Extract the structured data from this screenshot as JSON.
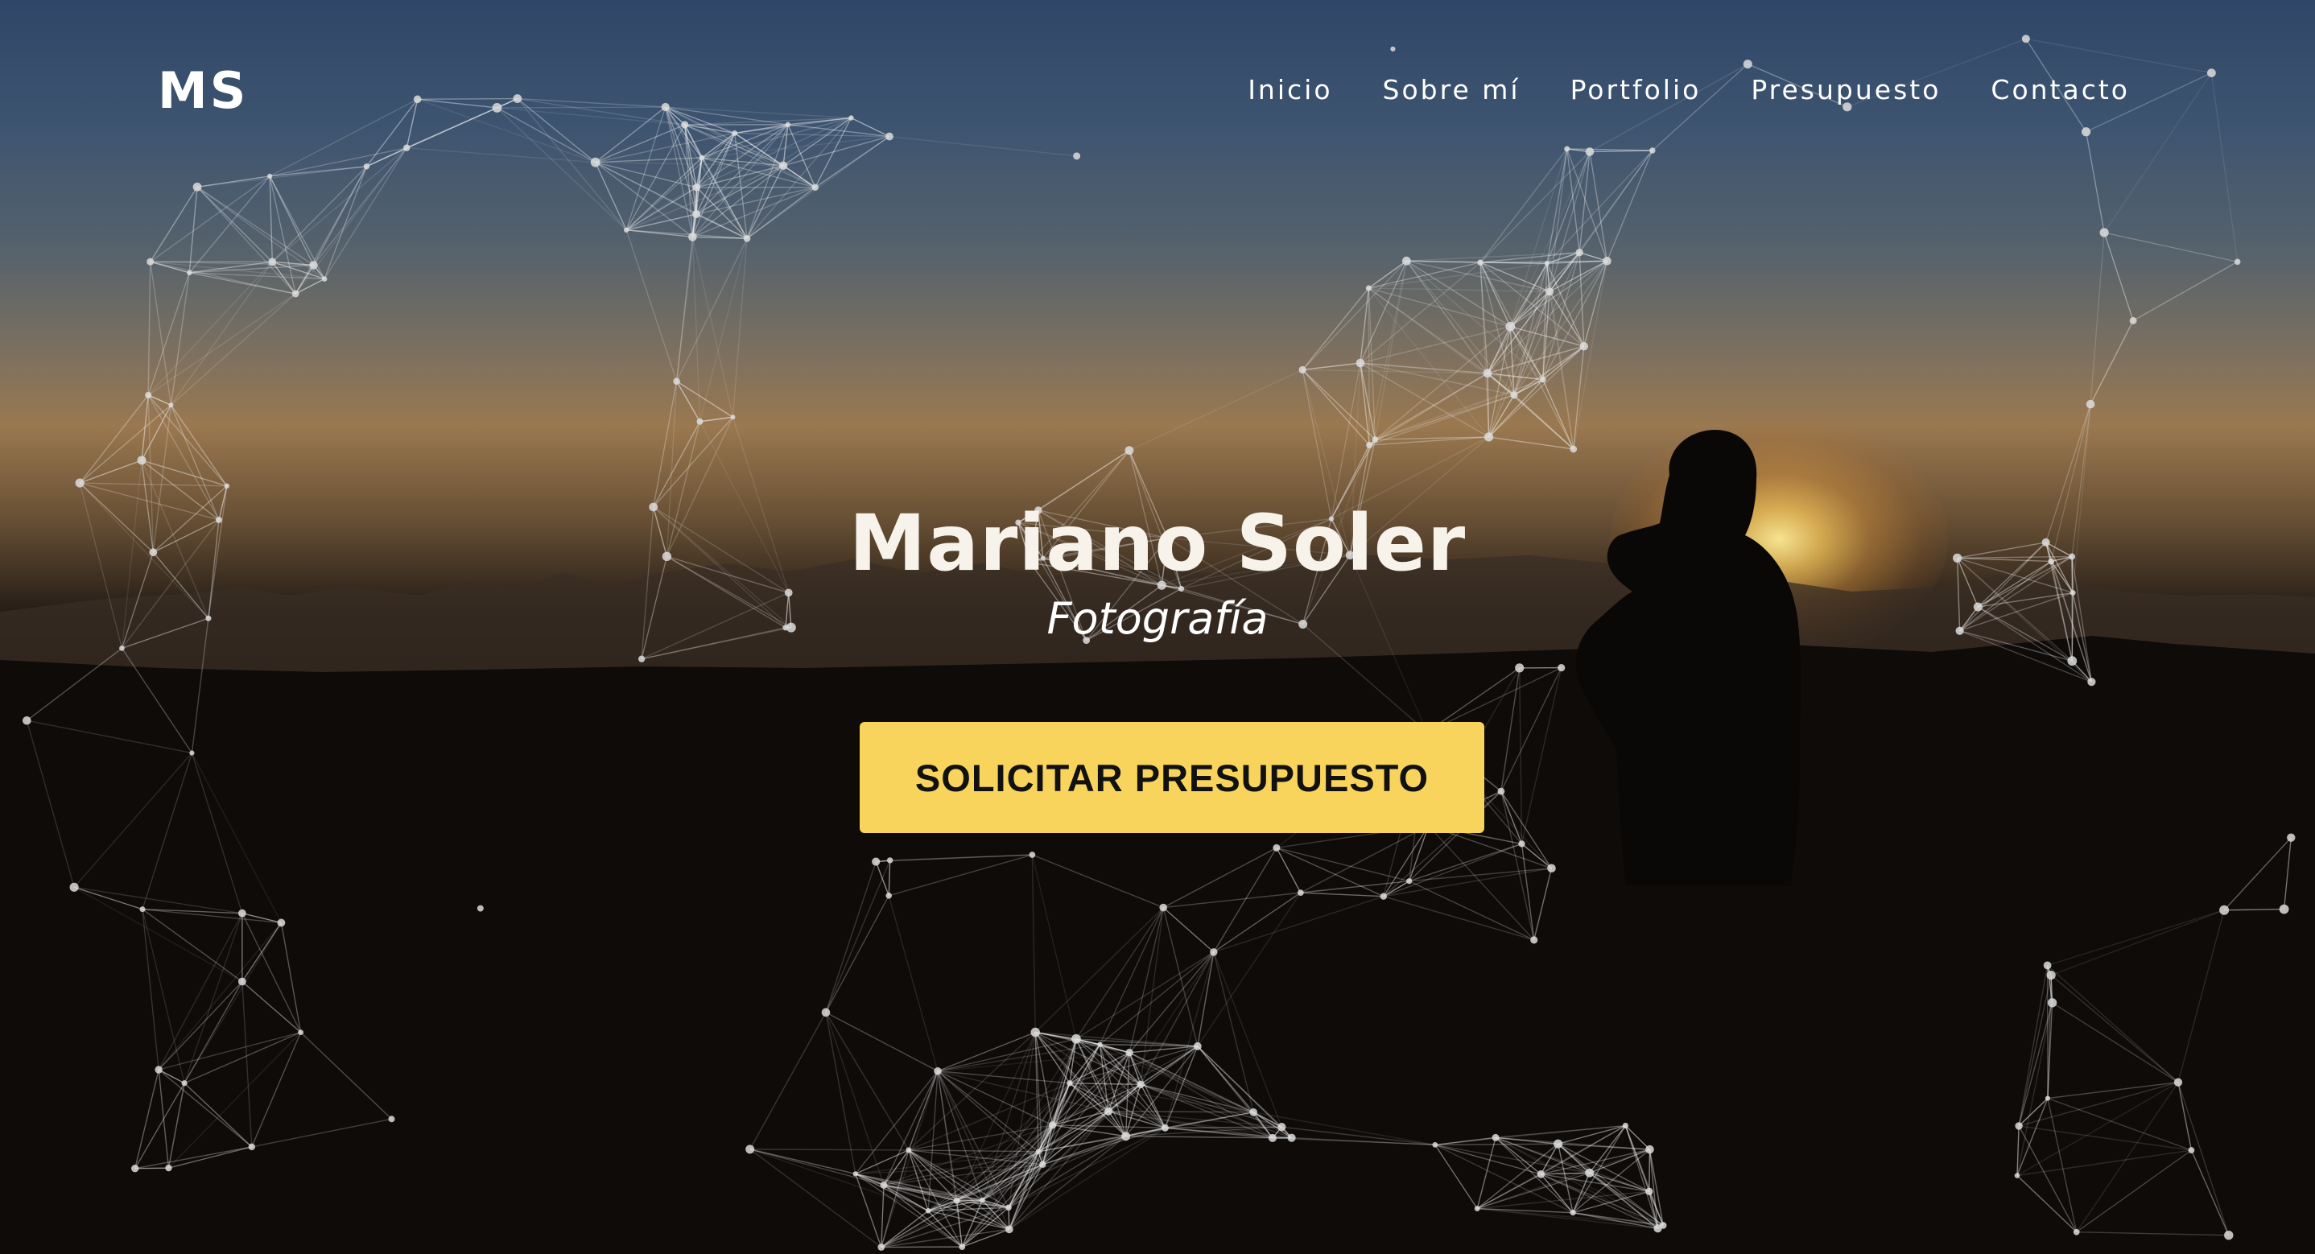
{
  "brand": {
    "logo": "MS"
  },
  "nav": {
    "items": [
      {
        "label": "Inicio"
      },
      {
        "label": "Sobre mí"
      },
      {
        "label": "Portfolio"
      },
      {
        "label": "Presupuesto"
      },
      {
        "label": "Contacto"
      }
    ]
  },
  "hero": {
    "title": "Mariano Soler",
    "subtitle": "Fotografía",
    "cta_label": "SOLICITAR PRESUPUESTO"
  },
  "colors": {
    "accent": "#f8d45c",
    "text": "#ffffff",
    "sky_top": "#2f4668",
    "horizon": "#9a7850"
  }
}
